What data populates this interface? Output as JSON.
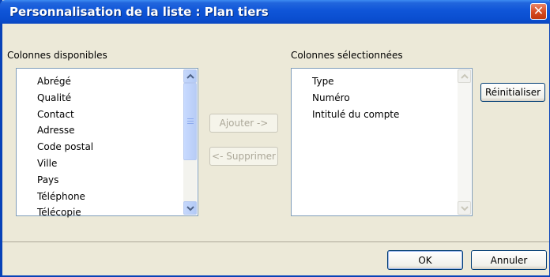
{
  "window": {
    "title": "Personnalisation de la liste : Plan tiers",
    "close_glyph": "✕"
  },
  "available": {
    "label": "Colonnes disponibles",
    "items": [
      "Abrégé",
      "Qualité",
      "Contact",
      "Adresse",
      "Code postal",
      "Ville",
      "Pays",
      "Téléphone",
      "Télécopie"
    ]
  },
  "selected": {
    "label": "Colonnes sélectionnées",
    "items": [
      "Type",
      "Numéro",
      "Intitulé du compte"
    ]
  },
  "buttons": {
    "add": "Ajouter ->",
    "remove": "<- Supprimer",
    "reset": "Réinitialiser",
    "ok": "OK",
    "cancel": "Annuler"
  },
  "colors": {
    "titlebar": "#0a4ed0",
    "dialog_bg": "#ece9d8",
    "close_button": "#d6491f"
  }
}
